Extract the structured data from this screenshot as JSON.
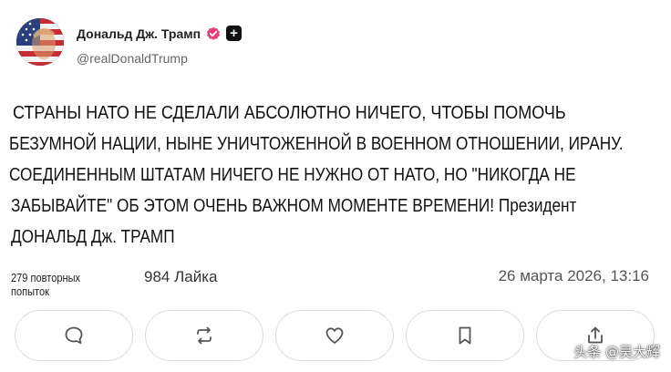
{
  "header": {
    "display_name": "Дональд Дж. Трамп",
    "handle": "@realDonaldTrump",
    "verified_color": "#e0407a"
  },
  "post": {
    "lines": [
      "СТРАНЫ НАТО НЕ СДЕЛАЛИ АБСОЛЮТНО НИЧЕГО, ЧТОБЫ ПОМОЧЬ",
      "БЕЗУМНОЙ НАЦИИ, НЫНЕ УНИЧТОЖЕННОЙ В ВОЕННОМ ОТНОШЕНИИ, ИРАНУ.",
      "СОЕДИНЕННЫМ ШТАТАМ НИЧЕГО НЕ НУЖНО ОТ НАТО, НО \"НИКОГДА НЕ",
      "ЗАБЫВАЙТЕ\" ОБ ЭТОМ ОЧЕНЬ ВАЖНОМ МОМЕНТЕ ВРЕМЕНИ! Президент",
      "ДОНАЛЬД Дж. ТРАМП"
    ]
  },
  "stats": {
    "reposts": "279 повторных попыток",
    "likes": "984 Лайка",
    "timestamp": "26 марта 2026, 13:16"
  },
  "actions": {
    "icons": [
      "comment-icon",
      "repost-icon",
      "heart-icon",
      "bookmark-icon",
      "share-icon"
    ]
  },
  "watermark": "头条 @吴大辉"
}
